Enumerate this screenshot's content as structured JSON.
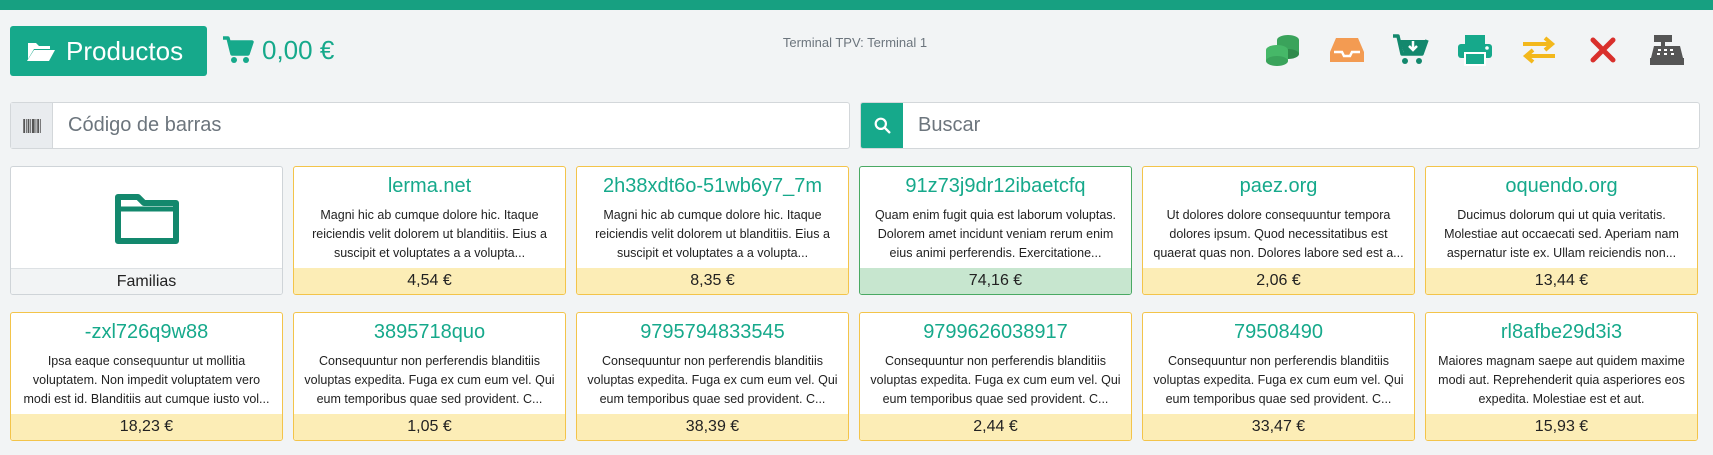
{
  "header": {
    "products_label": "Productos",
    "cart_total": "0,00 €",
    "terminal": "Terminal TPV: Terminal 1"
  },
  "actions": [
    {
      "icon": "coins-icon",
      "color": "#3aa35b"
    },
    {
      "icon": "inbox-tray-icon",
      "color": "#f39b52"
    },
    {
      "icon": "cart-download-icon",
      "color": "#13886d"
    },
    {
      "icon": "printer-icon",
      "color": "#16a98b"
    },
    {
      "icon": "exchange-arrows-icon",
      "color": "#f3b81c"
    },
    {
      "icon": "close-icon",
      "color": "#d9302c"
    },
    {
      "icon": "cash-register-icon",
      "color": "#555555"
    }
  ],
  "barcode": {
    "placeholder": "Código de barras",
    "value": ""
  },
  "search": {
    "placeholder": "Buscar",
    "value": ""
  },
  "family": {
    "label": "Familias"
  },
  "products": [
    {
      "name": "lerma.net",
      "desc": "Magni hic ab cumque dolore hic. Itaque reiciendis velit dolorem ut blanditiis. Eius a suscipit et voluptates a a volupta...",
      "price": "4,54 €"
    },
    {
      "name": "2h38xdt6o-51wb6y7_7m",
      "desc": "Magni hic ab cumque dolore hic. Itaque reiciendis velit dolorem ut blanditiis. Eius a suscipit et voluptates a a volupta...",
      "price": "8,35 €"
    },
    {
      "name": "91z73j9dr12ibaetcfq",
      "desc": "Quam enim fugit quia est laborum voluptas. Dolorem amet incidunt veniam rerum enim eius animi perferendis. Exercitatione...",
      "price": "74,16 €",
      "selected": true
    },
    {
      "name": "paez.org",
      "desc": "Ut dolores dolore consequuntur tempora dolores ipsum. Quod necessitatibus est quaerat quas non. Dolores labore sed est a...",
      "price": "2,06 €"
    },
    {
      "name": "oquendo.org",
      "desc": "Ducimus dolorum qui ut quia veritatis. Molestiae aut occaecati sed. Aperiam nam aspernatur iste ex. Ullam reiciendis non...",
      "price": "13,44 €"
    },
    {
      "name": "-zxl726q9w88",
      "desc": "Ipsa eaque consequuntur ut mollitia voluptatem. Non impedit voluptatem vero modi est id. Blanditiis aut cumque iusto vol...",
      "price": "18,23 €"
    },
    {
      "name": "3895718quo",
      "desc": "Consequuntur non perferendis blanditiis voluptas expedita. Fuga ex cum eum vel. Qui eum temporibus quae sed provident. C...",
      "price": "1,05 €"
    },
    {
      "name": "9795794833545",
      "desc": "Consequuntur non perferendis blanditiis voluptas expedita. Fuga ex cum eum vel. Qui eum temporibus quae sed provident. C...",
      "price": "38,39 €"
    },
    {
      "name": "9799626038917",
      "desc": "Consequuntur non perferendis blanditiis voluptas expedita. Fuga ex cum eum vel. Qui eum temporibus quae sed provident. C...",
      "price": "2,44 €"
    },
    {
      "name": "79508490",
      "desc": "Consequuntur non perferendis blanditiis voluptas expedita. Fuga ex cum eum vel. Qui eum temporibus quae sed provident. C...",
      "price": "33,47 €"
    },
    {
      "name": "rl8afbe29d3i3",
      "desc": "Maiores magnam saepe aut quidem maxime modi aut. Reprehenderit quia asperiores eos expedita. Molestiae est et aut.",
      "price": "15,93 €"
    }
  ]
}
